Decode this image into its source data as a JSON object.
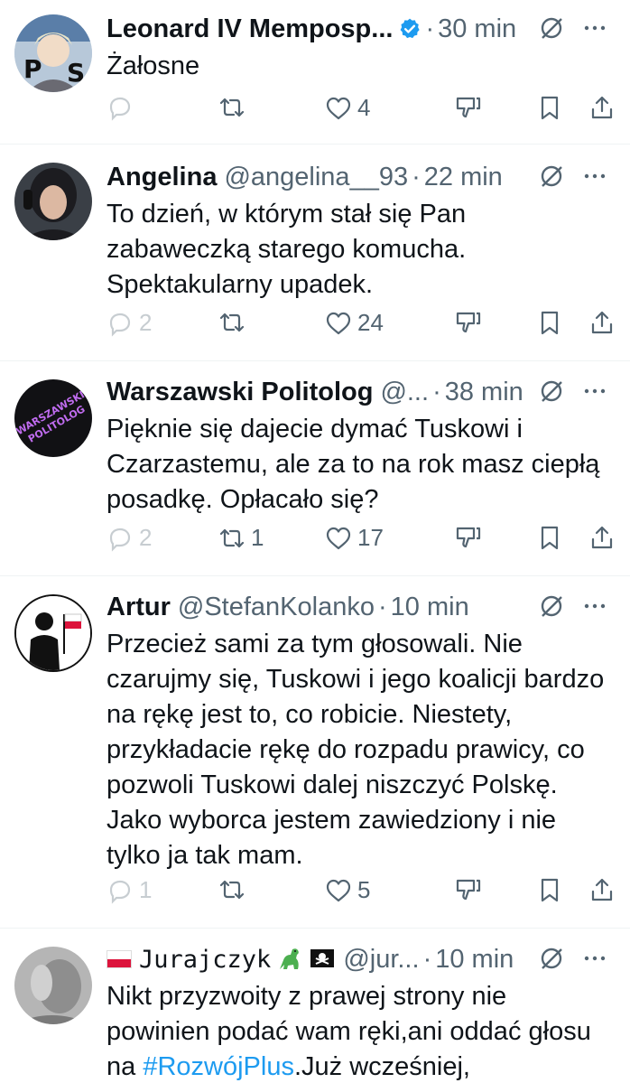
{
  "tweets": [
    {
      "name": "Leonard IV Memposp...",
      "handle": "",
      "verified": true,
      "time": "30 min",
      "text": [
        "Żałosne"
      ],
      "avatar": "anime-avatar",
      "replies": "",
      "retweets": "",
      "likes": "4"
    },
    {
      "name": "Angelina",
      "handle": "@angelina__93",
      "time": "22 min",
      "text": [
        "To dzień, w którym stał się Pan",
        "zabaweczką starego komucha.",
        "Spektakularny upadek."
      ],
      "avatar": "woman-avatar",
      "replies": "2",
      "retweets": "",
      "likes": "24"
    },
    {
      "name": "Warszawski Politolog",
      "handle": "@...",
      "time": "38 min",
      "text": [
        "Pięknie się dajecie dymać Tuskowi i",
        "Czarzastemu, ale za to na rok masz ciepłą",
        "posadkę. Opłacało się?"
      ],
      "avatar": "warszawski-politolog-logo",
      "avatar_text": [
        "WARSZAWSKI",
        "POLITOLOG"
      ],
      "replies": "2",
      "retweets": "1",
      "likes": "17"
    },
    {
      "name": "Artur",
      "handle": "@StefanKolanko",
      "time": "10 min",
      "text": [
        "Przecież sami za tym głosowali. Nie",
        "czarujmy się, Tuskowi i jego koalicji bardzo",
        "na rękę jest to, co robicie. Niestety,",
        "przykładacie rękę do rozpadu prawicy, co",
        "pozwoli Tuskowi dalej niszczyć Polskę.",
        "Jako wyborca jestem zawiedziony i nie",
        "tylko ja tak mam."
      ],
      "avatar": "silhouette-flag-avatar",
      "replies": "1",
      "retweets": "",
      "likes": "5"
    },
    {
      "name": "Jurajczyk",
      "handle": "@jur...",
      "time": "10 min",
      "text_line1": "Nikt przyzwoity z prawej strony nie",
      "text_line2": "powinien podać wam ręki,ani oddać głosu",
      "text_line3_tag": "#RozwójPlus",
      "text_line3_pre": "na ",
      "text_line3_post": ".Już wcześniej,",
      "avatar": "grey-photo-avatar"
    }
  ],
  "colors": {
    "text": "#0f1419",
    "secondary": "#536471",
    "verified": "#1d9bf0",
    "hashtag": "#1d9bf0",
    "divider": "#eff3f4"
  }
}
